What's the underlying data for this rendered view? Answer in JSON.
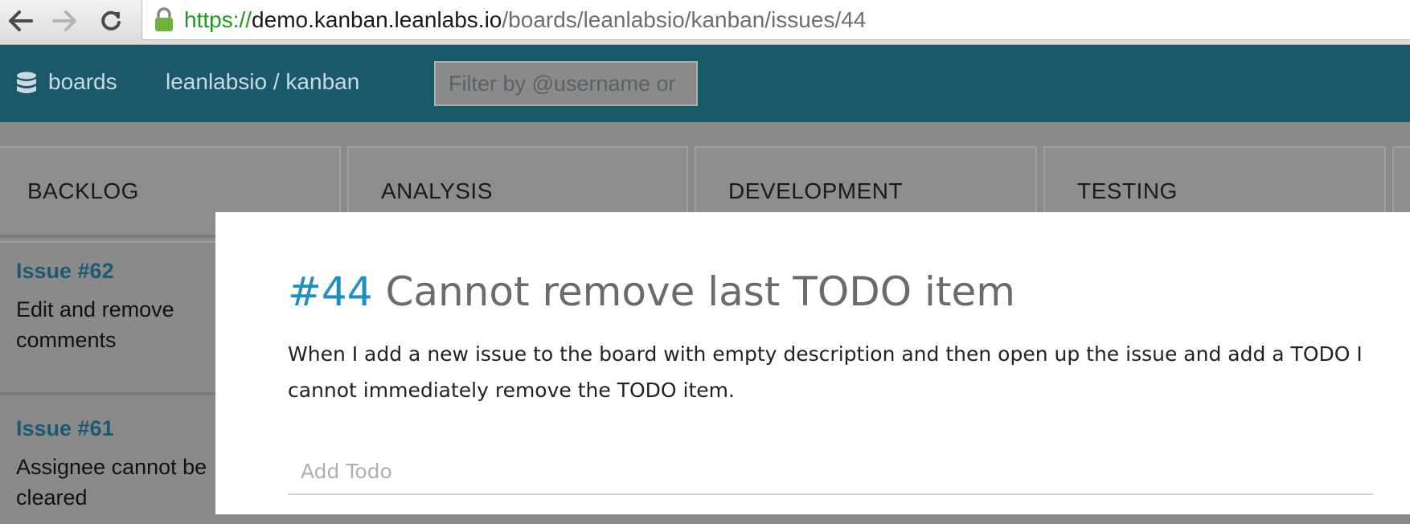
{
  "browser": {
    "url_scheme": "https://",
    "url_host": "demo.kanban.leanlabs.io",
    "url_path": "/boards/leanlabsio/kanban/issues/44",
    "back_icon": "arrow-left-icon",
    "forward_icon": "arrow-right-icon",
    "reload_icon": "reload-icon",
    "lock_icon": "lock-icon",
    "lock_color": "#6fb33a"
  },
  "header": {
    "boards_label": "boards",
    "boards_icon": "database-icon",
    "project_label": "leanlabsio / kanban",
    "filter_placeholder": "Filter by @username or",
    "background_color": "#1a5969"
  },
  "board": {
    "columns": [
      {
        "title": "BACKLOG"
      },
      {
        "title": "ANALYSIS"
      },
      {
        "title": "DEVELOPMENT"
      },
      {
        "title": "TESTING"
      }
    ],
    "backlog_cards": [
      {
        "issue": "Issue #62",
        "title": "Edit and remove comments"
      },
      {
        "issue": "Issue #61",
        "title": "Assignee cannot be cleared"
      }
    ]
  },
  "modal": {
    "number": "#44",
    "title": "Cannot remove last TODO item",
    "description": "When I add a new issue to the board with empty description and then open up the issue and add a TODO I cannot immediately remove the TODO item.",
    "todo_placeholder": "Add Todo",
    "number_color": "#1e8fbf"
  }
}
